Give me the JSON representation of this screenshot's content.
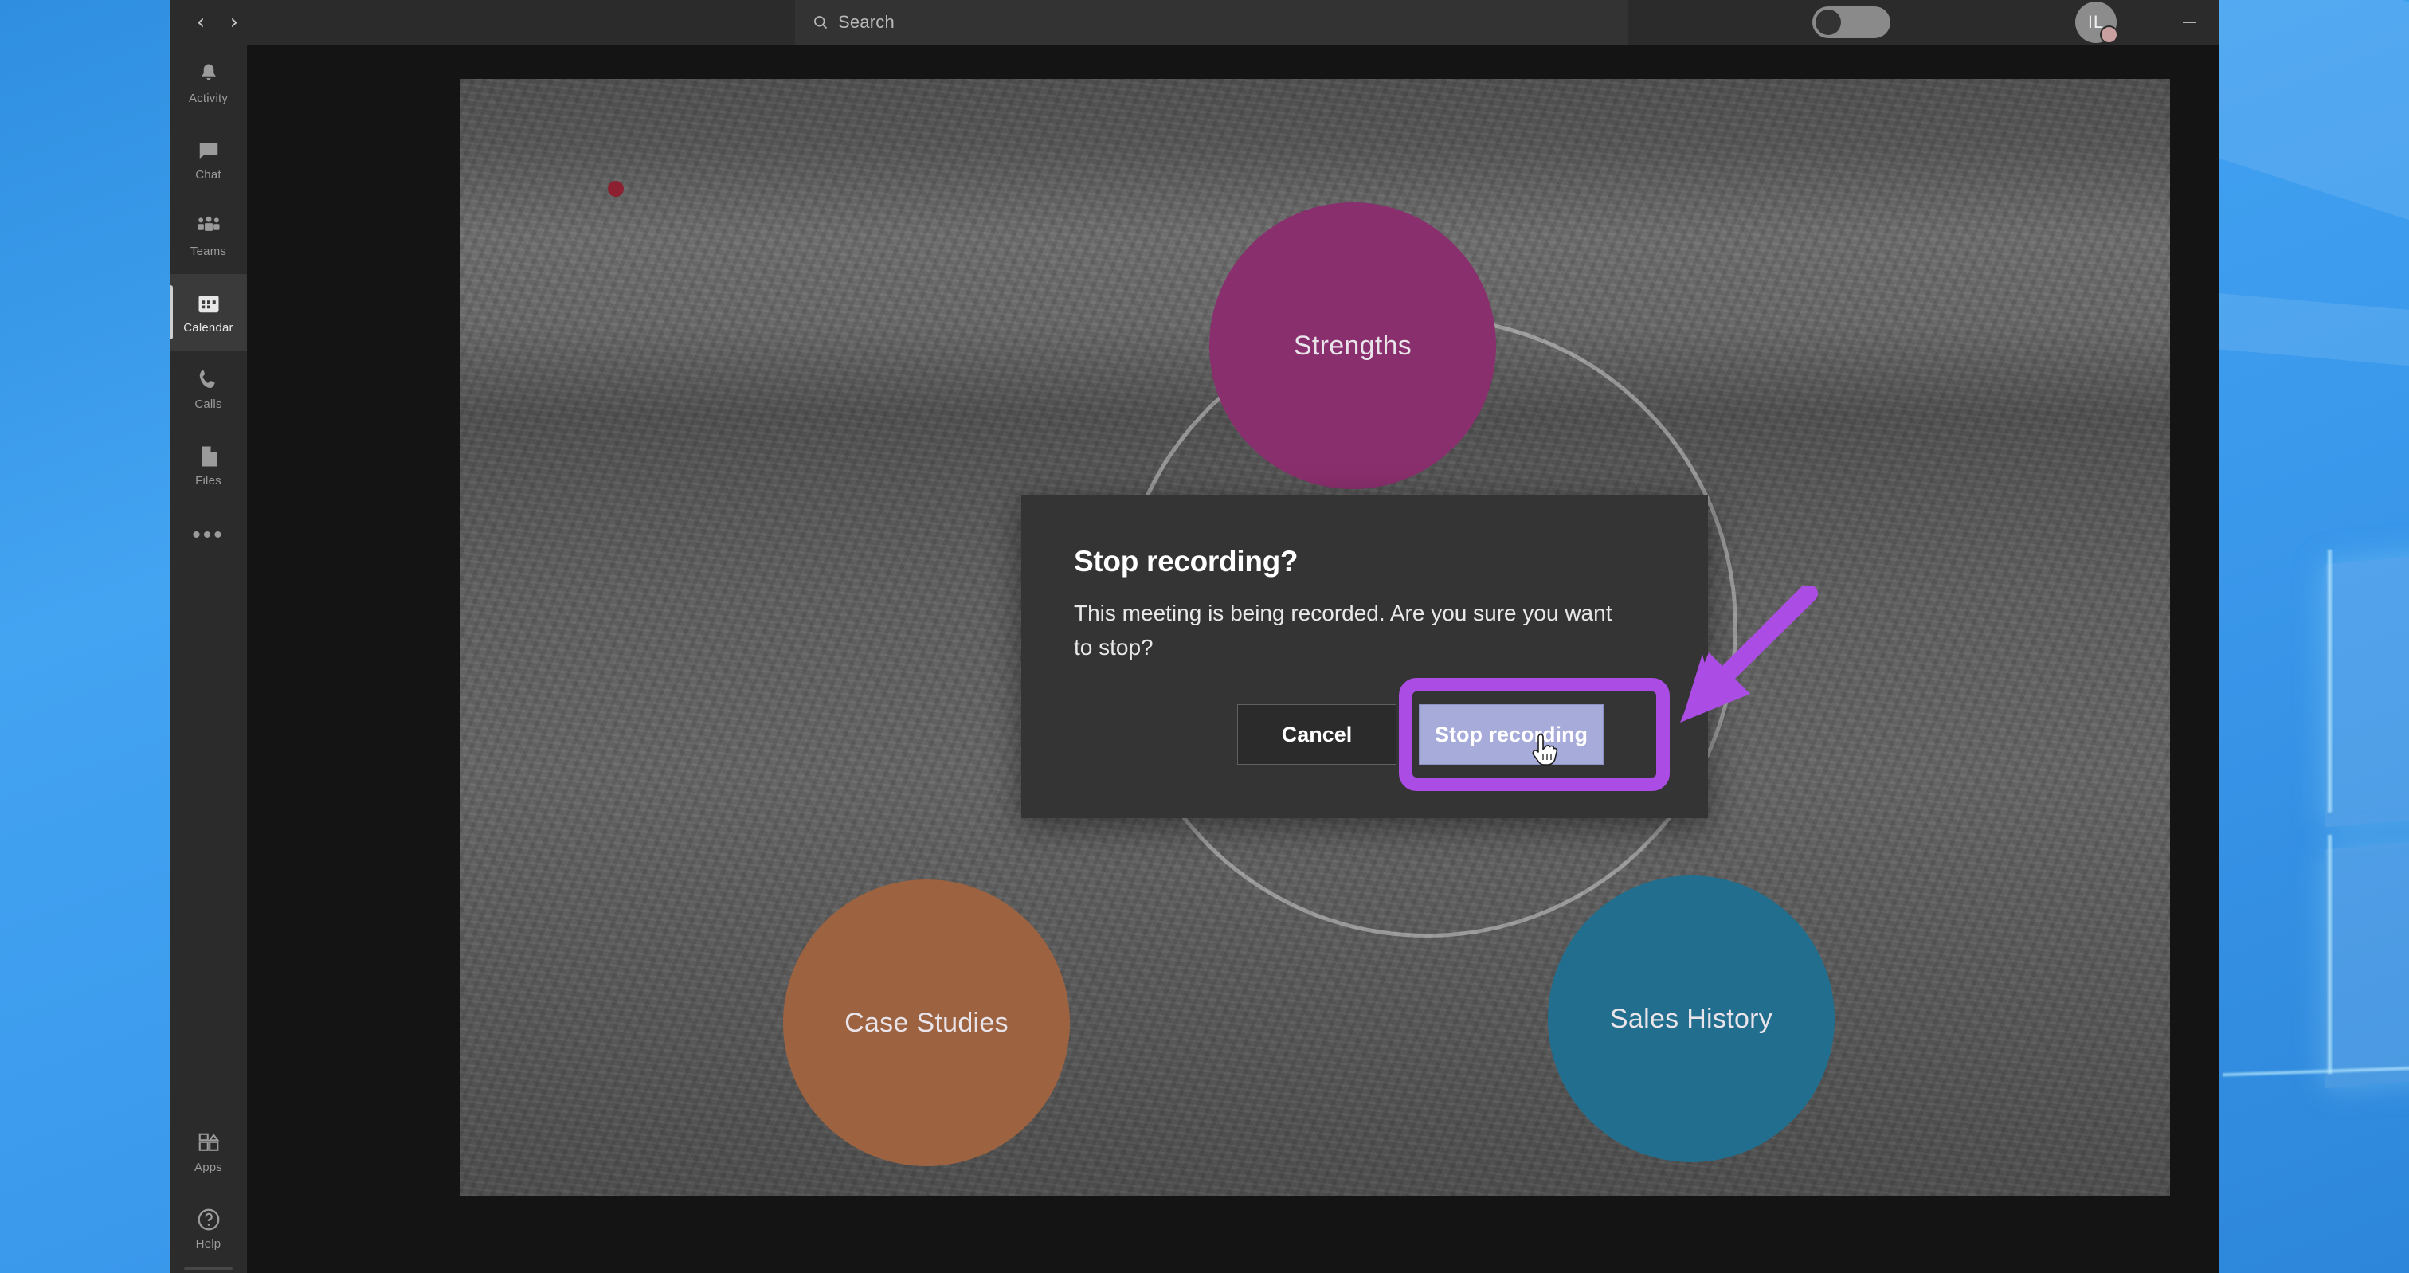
{
  "desktop": {
    "wallpaper_name": "windows-default-blue",
    "accent": "#3fa0f0"
  },
  "titlebar": {
    "back_icon": "chevron-left-icon",
    "forward_icon": "chevron-right-icon",
    "back_glyph": "‹",
    "forward_glyph": "›",
    "search": {
      "placeholder": "Search",
      "value": "",
      "icon": "search-icon"
    },
    "theme_toggle": {
      "name": "toggle-switch",
      "state": "off"
    },
    "avatar": {
      "initials": "IL",
      "presence": "away"
    },
    "window_controls": {
      "minimize": {
        "icon": "minimize-icon",
        "glyph": "—"
      },
      "maximize": {
        "icon": "maximize-icon",
        "glyph": "❑"
      },
      "close": {
        "icon": "close-icon",
        "glyph": "✕"
      }
    }
  },
  "rail": {
    "items": [
      {
        "label": "Activity",
        "icon": "bell-icon",
        "active": false
      },
      {
        "label": "Chat",
        "icon": "chat-icon",
        "active": false
      },
      {
        "label": "Teams",
        "icon": "teams-icon",
        "active": false
      },
      {
        "label": "Calendar",
        "icon": "calendar-icon",
        "active": true
      },
      {
        "label": "Calls",
        "icon": "phone-icon",
        "active": false
      },
      {
        "label": "Files",
        "icon": "files-icon",
        "active": false
      }
    ],
    "more": {
      "label": "•••",
      "icon": "more-horizontal-icon"
    },
    "bottom_items": [
      {
        "label": "Apps",
        "icon": "apps-icon"
      },
      {
        "label": "Help",
        "icon": "help-circle-icon"
      }
    ]
  },
  "stage": {
    "recording_indicator": {
      "icon": "recording-dot-icon",
      "color": "#8d2030"
    },
    "bubbles": [
      {
        "label": "Strengths",
        "color": "#8a2f6d"
      },
      {
        "label": "Case Studies",
        "color": "#9d6341"
      },
      {
        "label": "Sales History",
        "color": "#226e8e"
      }
    ]
  },
  "dialog": {
    "title": "Stop recording?",
    "body": "This meeting is being recorded. Are you sure you want to stop?",
    "cancel_label": "Cancel",
    "confirm_label": "Stop recording"
  },
  "annotation": {
    "highlight_color": "#ab4ce4",
    "arrow_icon": "arrow-down-left-icon",
    "cursor_icon": "pointer-hand-icon",
    "target": "Stop recording"
  }
}
